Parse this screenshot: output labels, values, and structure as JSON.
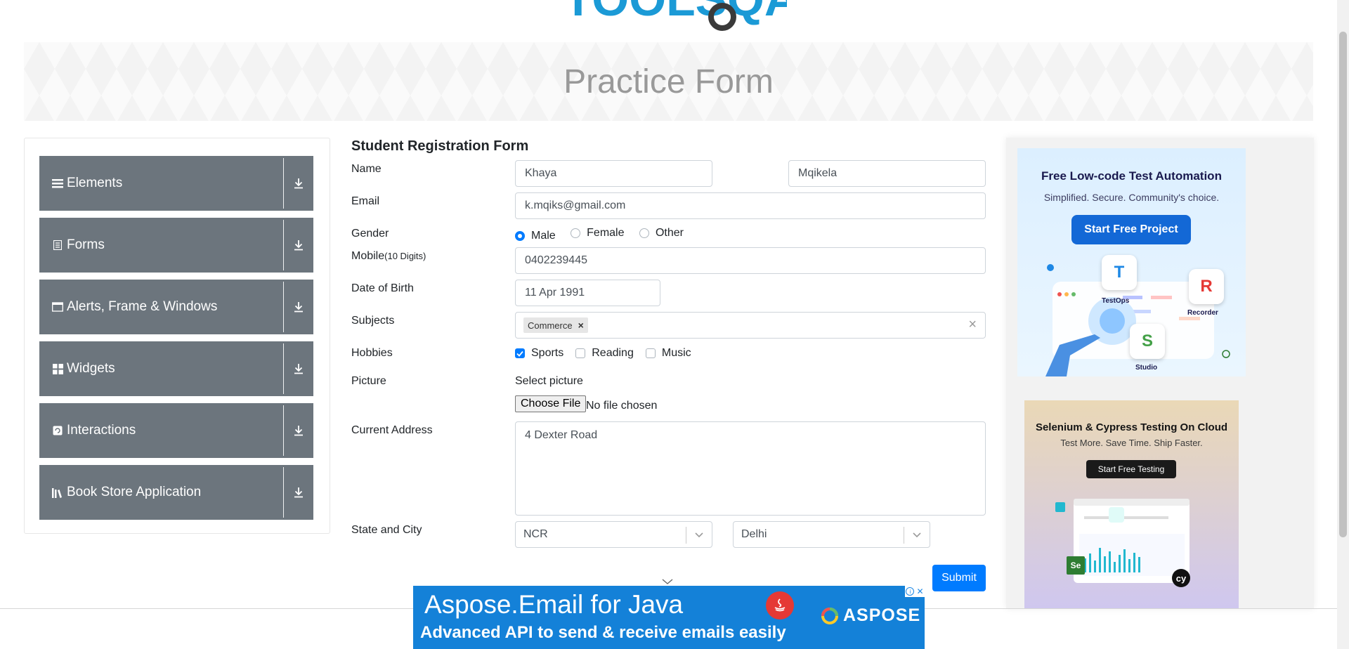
{
  "logo": {
    "text": "TOOLSQA"
  },
  "banner": {
    "title": "Practice Form"
  },
  "sidebar": {
    "groups": [
      {
        "label": "Elements",
        "icon": "hamburger-icon"
      },
      {
        "label": "Forms",
        "icon": "document-icon"
      },
      {
        "label": "Alerts, Frame & Windows",
        "icon": "window-icon"
      },
      {
        "label": "Widgets",
        "icon": "grid-icon"
      },
      {
        "label": "Interactions",
        "icon": "refresh-icon"
      },
      {
        "label": "Book Store Application",
        "icon": "books-icon"
      }
    ]
  },
  "form": {
    "title": "Student Registration Form",
    "name": {
      "label": "Name",
      "first": "Khaya",
      "last": "Mqikela"
    },
    "email": {
      "label": "Email",
      "value": "k.mqiks@gmail.com"
    },
    "gender": {
      "label": "Gender",
      "options": [
        "Male",
        "Female",
        "Other"
      ],
      "selected": "Male"
    },
    "mobile": {
      "label": "Mobile",
      "hint": "(10 Digits)",
      "value": "0402239445"
    },
    "dob": {
      "label": "Date of Birth",
      "value": "11 Apr 1991"
    },
    "subjects": {
      "label": "Subjects",
      "tags": [
        "Commerce"
      ],
      "tag_remove": "×",
      "clear": "×"
    },
    "hobbies": {
      "label": "Hobbies",
      "options": [
        "Sports",
        "Reading",
        "Music"
      ],
      "checked": [
        "Sports"
      ]
    },
    "picture": {
      "label": "Picture",
      "select_text": "Select picture",
      "button": "Choose File",
      "status": "No file chosen"
    },
    "address": {
      "label": "Current Address",
      "value": "4 Dexter Road"
    },
    "state_city": {
      "label": "State and City",
      "state": "NCR",
      "city": "Delhi"
    },
    "submit": "Submit"
  },
  "ads": {
    "ad1": {
      "title": "Free Low-code Test Automation",
      "subtitle": "Simplified. Secure. Community's choice.",
      "button": "Start Free Project",
      "cards": [
        "TestOps",
        "Recorder",
        "Studio"
      ],
      "card_letters": [
        "T",
        "R",
        "S"
      ]
    },
    "ad2": {
      "title": "Selenium & Cypress Testing On Cloud",
      "subtitle": "Test More. Save Time. Ship Faster.",
      "button": "Start Free Testing",
      "logos": [
        "Se",
        "cy"
      ]
    },
    "bottom": {
      "title": "Aspose.Email for Java",
      "subtitle": "Advanced API to send & receive emails easily",
      "brand": "ASPOSE"
    }
  },
  "colors": {
    "sidebar_group": "#6c757d",
    "primary": "#007bff",
    "banner_title": "#999999",
    "bottom_ad": "#1481d8"
  }
}
